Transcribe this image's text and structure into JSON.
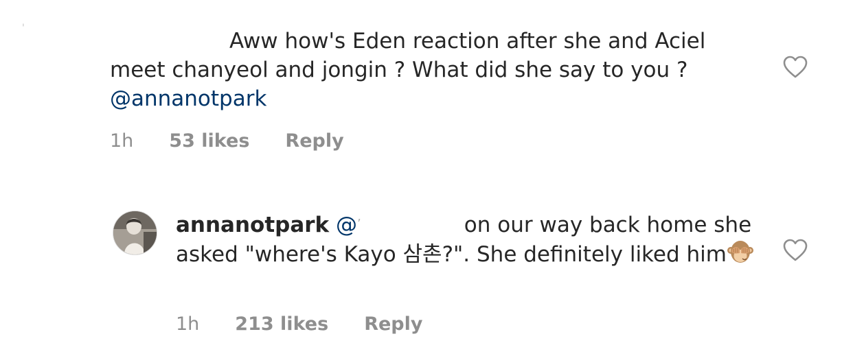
{
  "stray_mark": "'",
  "comments": [
    {
      "text": "Aww how's Eden reaction after she and Aciel meet chanyeol and jongin ? What did she say to you ? ",
      "mention": "@annanotpark",
      "time": "1h",
      "likes": "53 likes",
      "reply": "Reply"
    },
    {
      "username": "annanotpark",
      "mention": "@",
      "mention_tail": "’",
      "text": "on our way back home she asked \"where's Kayo 삼촌?\". She definitely liked him",
      "emoji": "see-no-evil-monkey",
      "time": "1h",
      "likes": "213 likes",
      "reply": "Reply"
    }
  ],
  "colors": {
    "text": "#262626",
    "meta": "#8e8e8e",
    "mention": "#003569",
    "icon": "#8e8e8e"
  },
  "icons": {
    "like": "heart-outline-icon"
  }
}
